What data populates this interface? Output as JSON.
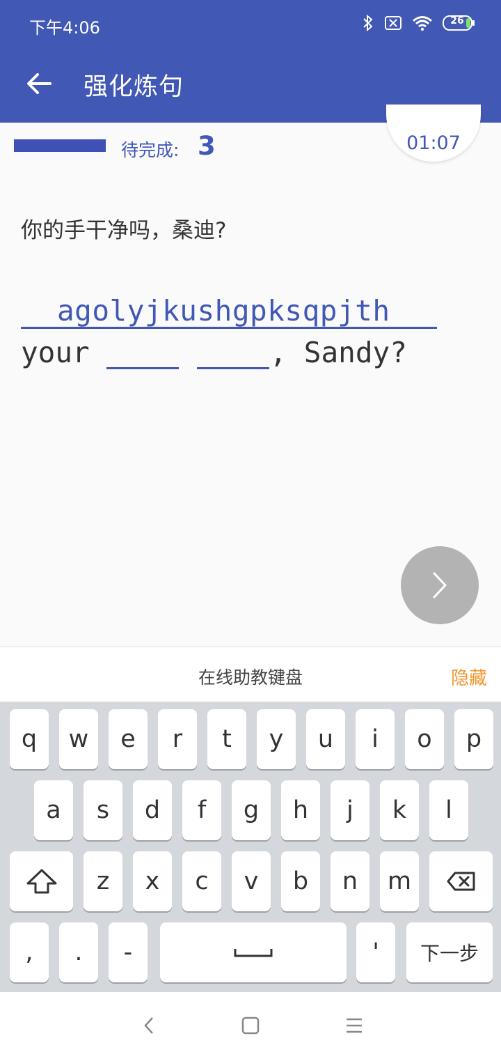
{
  "status_bar": {
    "time": "下午4:06",
    "battery": "26"
  },
  "app_bar": {
    "title": "强化炼句"
  },
  "progress": {
    "pending_label": "待完成:",
    "pending_count": "3",
    "timer": "01:07"
  },
  "exercise": {
    "question": "你的手干净吗，桑迪?",
    "answer_input": "agolyjkushgpksqpjth",
    "sentence_start": "your",
    "sentence_end": ", Sandy?"
  },
  "keyboard": {
    "title": "在线助教键盘",
    "hide_label": "隐藏",
    "row1": [
      "q",
      "w",
      "e",
      "r",
      "t",
      "y",
      "u",
      "i",
      "o",
      "p"
    ],
    "row2": [
      "a",
      "s",
      "d",
      "f",
      "g",
      "h",
      "j",
      "k",
      "l"
    ],
    "row3": [
      "z",
      "x",
      "c",
      "v",
      "b",
      "n",
      "m"
    ],
    "comma": ",",
    "period": ".",
    "dash": "-",
    "apostrophe": "'",
    "next_label": "下一步"
  }
}
